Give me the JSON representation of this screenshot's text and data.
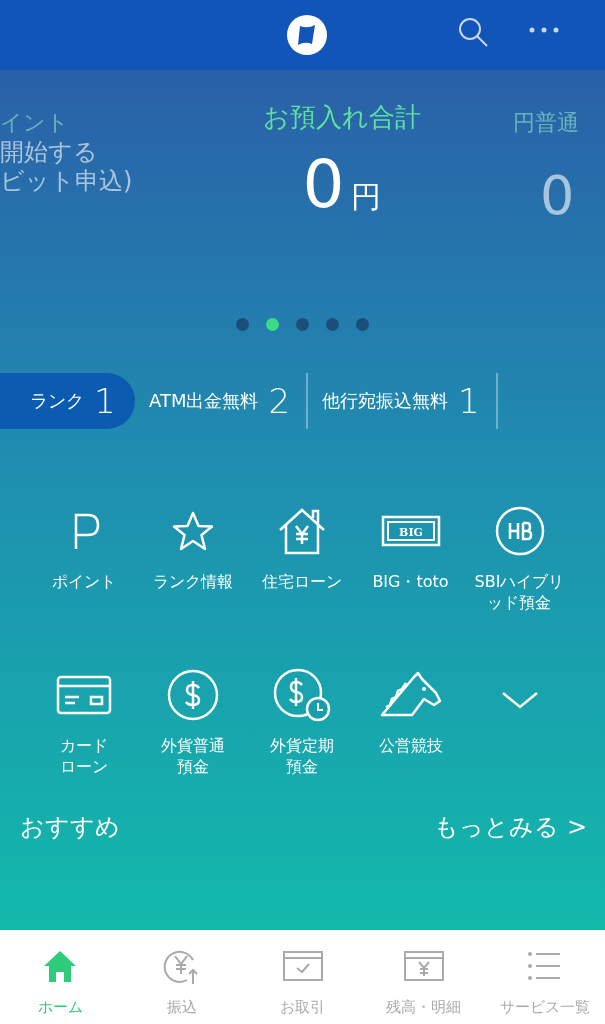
{
  "carousel": {
    "slides": [
      {
        "title": "イント",
        "lines": [
          "開始する",
          "ビット申込)"
        ],
        "selected": false
      },
      {
        "title": "お預入れ合計",
        "amount": "0",
        "unit": "円",
        "selected": true
      },
      {
        "title": "円普通",
        "amount": "0",
        "selected": false
      }
    ],
    "dots": [
      {
        "selected": false
      },
      {
        "selected": true
      },
      {
        "selected": false
      },
      {
        "selected": false
      },
      {
        "selected": false
      }
    ]
  },
  "perks": [
    {
      "label": "ランク",
      "value": "1",
      "kind": "rank"
    },
    {
      "label": "ATM出金無料",
      "value": "2",
      "kind": "perk"
    },
    {
      "label": "他行宛振込無料",
      "value": "1",
      "kind": "perk"
    }
  ],
  "menu": {
    "items": [
      {
        "lines": [
          "ポイント"
        ]
      },
      {
        "lines": [
          "ランク情報"
        ]
      },
      {
        "lines": [
          "住宅ローン"
        ]
      },
      {
        "lines": [
          "BIG・toto"
        ],
        "icon_text": "BIG"
      },
      {
        "lines": [
          "SBIハイブリ",
          "ッド預金"
        ]
      },
      {
        "lines": [
          "カード",
          "ローン"
        ]
      },
      {
        "lines": [
          "外貨普通",
          "預金"
        ]
      },
      {
        "lines": [
          "外貨定期",
          "預金"
        ]
      },
      {
        "lines": [
          "公営競技"
        ]
      }
    ]
  },
  "recommend": {
    "title": "おすすめ",
    "more": "もっとみる >"
  },
  "tabs": [
    {
      "label": "ホーム",
      "selected": true
    },
    {
      "label": "振込",
      "selected": false
    },
    {
      "label": "お取引",
      "selected": false
    },
    {
      "label": "残高・明細",
      "selected": false
    },
    {
      "label": "サービス一覧",
      "selected": false
    }
  ]
}
